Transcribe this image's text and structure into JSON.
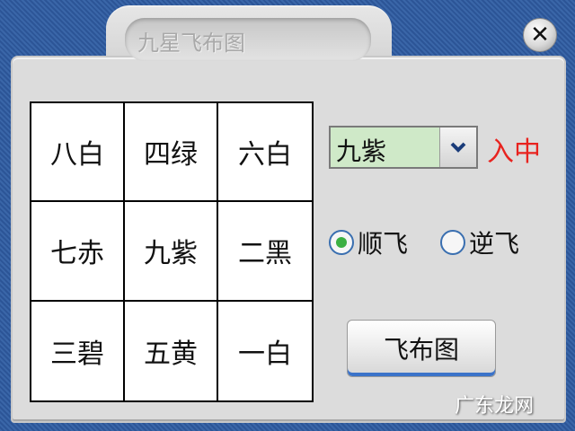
{
  "window": {
    "title": "九星飞布图"
  },
  "grid": {
    "cells": [
      "八白",
      "四绿",
      "六白",
      "七赤",
      "九紫",
      "二黑",
      "三碧",
      "五黄",
      "一白"
    ]
  },
  "controls": {
    "star_select": {
      "value": "九紫"
    },
    "enter_center_label": "入中",
    "radio_options": [
      {
        "label": "顺飞",
        "checked": true
      },
      {
        "label": "逆飞",
        "checked": false
      }
    ],
    "draw_button_label": "飞布图"
  },
  "watermark": "广东龙网",
  "colors": {
    "background": "#2f5a9c",
    "panel": "#dcdcdc",
    "select_fill": "#cfe9c8",
    "enter_label": "#e8231f",
    "radio_dot": "#3cb043"
  }
}
